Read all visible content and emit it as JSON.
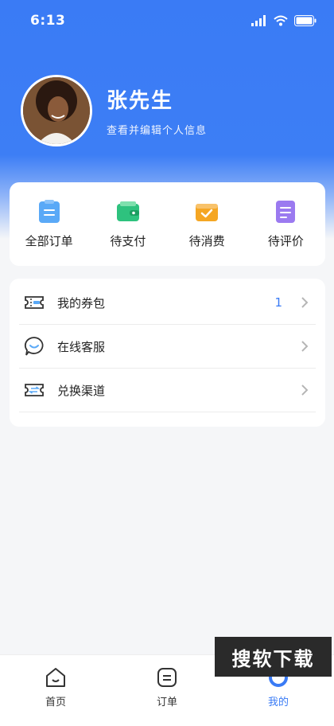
{
  "status_bar": {
    "time": "6:13"
  },
  "profile": {
    "name": "张先生",
    "subtitle": "查看并编辑个人信息"
  },
  "orders": [
    {
      "label": "全部订单",
      "icon": "clipboard-icon",
      "color": "#5aa9f7"
    },
    {
      "label": "待支付",
      "icon": "wallet-icon",
      "color": "#2ec27e"
    },
    {
      "label": "待消费",
      "icon": "ticket-check-icon",
      "color": "#f5a623"
    },
    {
      "label": "待评价",
      "icon": "document-edit-icon",
      "color": "#9b7af0"
    }
  ],
  "menu": [
    {
      "label": "我的券包",
      "count": "1",
      "icon": "coupon-icon"
    },
    {
      "label": "在线客服",
      "count": "",
      "icon": "chat-icon"
    },
    {
      "label": "兑换渠道",
      "count": "",
      "icon": "exchange-icon"
    }
  ],
  "tabbar": [
    {
      "label": "首页",
      "icon": "home-icon",
      "active": false
    },
    {
      "label": "订单",
      "icon": "order-icon",
      "active": false
    },
    {
      "label": "我的",
      "icon": "profile-icon",
      "active": true
    }
  ],
  "watermark": "搜软下载",
  "colors": {
    "primary": "#3a7bf5",
    "background": "#f5f6f8"
  }
}
